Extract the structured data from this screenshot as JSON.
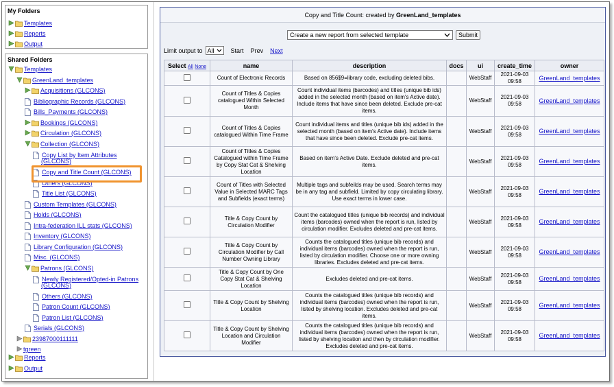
{
  "my_folders": {
    "title": "My Folders",
    "items": [
      "Templates",
      "Reports",
      "Output"
    ]
  },
  "shared_folders": {
    "title": "Shared Folders",
    "templates": "Templates",
    "greenland": "GreenLand_templates",
    "items": [
      "Acquisitions (GLCONS)",
      "Bibliographic Records (GLCONS)",
      "Bills_Payments (GLCONS)",
      "Bookings (GLCONS)",
      "Circulation (GLCONS)",
      "Collection (GLCONS)",
      "Copy List by Item Attributes",
      "(GLCONS)",
      "Copy and Title Count (GLCONS)",
      "Others (GLCONS)",
      "Title List (GLCONS)",
      "Custom Templates (GLCONS)",
      "Holds (GLCONS)",
      "Intra-federation ILL stats (GLCONS)",
      "Inventory (GLCONS)",
      "Library Configuration (GLCONS)",
      "Misc. (GLCONS)",
      "Patrons (GLCONS)",
      "Newly Registered/Opted-in Patrons",
      "(GLCONS)",
      "Others (GLCONS)",
      "Patron Count (GLCONS)",
      "Patron List (GLCONS)",
      "Serials (GLCONS)",
      "23987000111111",
      "tgreen",
      "Reports",
      "Output"
    ]
  },
  "header": {
    "title_prefix": "Copy and Title Count",
    "title_mid": ": created by ",
    "creator": "GreenLand_templates"
  },
  "template_select": {
    "value": "Create a new report from selected template",
    "submit": "Submit"
  },
  "limit": {
    "label": "Limit output to",
    "value": "All",
    "start": "Start",
    "prev": "Prev",
    "next": "Next"
  },
  "table": {
    "headers": {
      "select": "Select",
      "all": "All",
      "none": "None",
      "name": "name",
      "description": "description",
      "docs": "docs",
      "ui": "ui",
      "create_time": "create_time",
      "owner": "owner"
    },
    "rows": [
      {
        "name": "Count of Electronic Records",
        "description": "Based on 856$9=library code, excluding deleted bibs.",
        "ui": "WebStaff",
        "date": "2021-09-03",
        "time": "09:58",
        "owner": "GreenLand_templates"
      },
      {
        "name": "Count of Titles & Copies catalogued Within Selected Month",
        "description": "Count individual items (barcodes) and titles (unique bib ids) added in the selected month (based on item's Active date). Include items that have since been deleted. Exclude pre-cat items.",
        "ui": "WebStaff",
        "date": "2021-09-03",
        "time": "09:58",
        "owner": "GreenLand_templates"
      },
      {
        "name": "Count of Titles & Copies catalogued Within Time Frame",
        "description": "Count individual items and titles (unique bib ids) added in the selected month (based on item's Active date). Include items that have since been deleted. Exclude pre-cat items.",
        "ui": "WebStaff",
        "date": "2021-09-03",
        "time": "09:58",
        "owner": "GreenLand_templates"
      },
      {
        "name": "Count of Titles & Copies Catalogued within Time Frame by Copy Stat Cat & Shelving Location",
        "description": "Based on item's Active Date. Exclude deleted and pre-cat items.",
        "ui": "WebStaff",
        "date": "2021-09-03",
        "time": "09:58",
        "owner": "GreenLand_templates"
      },
      {
        "name": "Count of Titles with Selected Value in Selected MARC Tags and Subfields (exact terms)",
        "description": "Multiple tags and subfeilds may be used. Search terms may be in any tag and subfield. Limited by copy circulating library. Use exact terms in lower case.",
        "ui": "WebStaff",
        "date": "2021-09-03",
        "time": "09:58",
        "owner": "GreenLand_templates"
      },
      {
        "name": "Title & Copy Count by Circulation Modifier",
        "description": "Count the catalogued titles (unique bib records) and individual items (barcodes) owned when the report is run, listed by circulation modifier. Excludes deleted and pre-cat items.",
        "ui": "WebStaff",
        "date": "2021-09-03",
        "time": "09:58",
        "owner": "GreenLand_templates"
      },
      {
        "name": "Title & Copy Count by Circulation Modifier by Call Number Owning Library",
        "description": "Counts the catalogued titles (unique bib records) and individual items (barcodes) owned when the report is run, listed by circulation modifier. Choose one or more owning libraries. Excludes deleted and pre-cat items.",
        "ui": "WebStaff",
        "date": "2021-09-03",
        "time": "09:58",
        "owner": "GreenLand_templates"
      },
      {
        "name": "Title & Copy Count by One Copy Stat Cat & Shelving Location",
        "description": "Excludes deleted and pre-cat items.",
        "ui": "WebStaff",
        "date": "2021-09-03",
        "time": "09:58",
        "owner": "GreenLand_templates"
      },
      {
        "name": "Title & Copy Count by Shelving Location",
        "description": "Counts the catalogued titles (unique bib records) and individual items (barcodes) owned when the report is run, listed by shelving location. Excludes deleted and pre-cat items.",
        "ui": "WebStaff",
        "date": "2021-09-03",
        "time": "09:58",
        "owner": "GreenLand_templates"
      },
      {
        "name": "Title & Copy Count by Shelving Location and Circulation Modifier",
        "description": "Counts the catalogued titles (unique bib records) and individual items (barcodes) owned when the report is run, listed by shelving location and then by circulation modifier. Excludes deleted and pre-cat items.",
        "ui": "WebStaff",
        "date": "2021-09-03",
        "time": "09:58",
        "owner": "GreenLand_templates"
      }
    ]
  },
  "colors": {
    "link": "#1414c8",
    "highlight": "#f0932e",
    "panel_border": "#4a5aa0"
  }
}
